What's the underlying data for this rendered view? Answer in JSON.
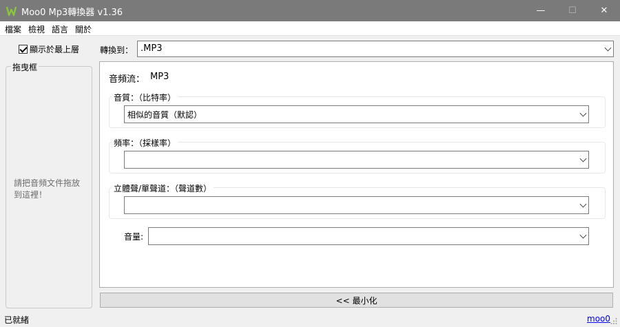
{
  "window": {
    "title": "Moo0 Mp3轉換器 v1.36",
    "min_icon": "minimize-icon",
    "max_icon": "maximize-icon",
    "close_icon": "close-icon",
    "min_glyph": "—",
    "max_glyph": "☐",
    "close_glyph": "✕"
  },
  "menu": [
    "檔案",
    "檢視",
    "語言",
    "關於"
  ],
  "sidebar": {
    "always_on_top_label": "顯示於最上層",
    "always_on_top_checked": true,
    "drop_group_title": "拖曳框",
    "drop_hint": "請把音頻文件拖放到這裡！"
  },
  "convert": {
    "label": "轉換到：",
    "value": ".MP3"
  },
  "panel": {
    "stream_label": "音頻流：",
    "stream_value": "MP3",
    "quality": {
      "title": "音質：（比特率）",
      "value": "相似的音質（默認）"
    },
    "frequency": {
      "title": "頻率：（採樣率）",
      "value": ""
    },
    "channels": {
      "title": "立體聲/單聲道：（聲道數）",
      "value": ""
    },
    "volume": {
      "label": "音量:",
      "value": ""
    }
  },
  "minimize_button": "<< 最小化",
  "status": {
    "text": "已就緒",
    "link": "moo0"
  },
  "colors": {
    "titlebar": "#7a7a7a",
    "window_bg": "#f0f0f0",
    "hint_text": "#6d6d6d",
    "link": "#0000ee",
    "icon_green": "#8bc53f"
  }
}
